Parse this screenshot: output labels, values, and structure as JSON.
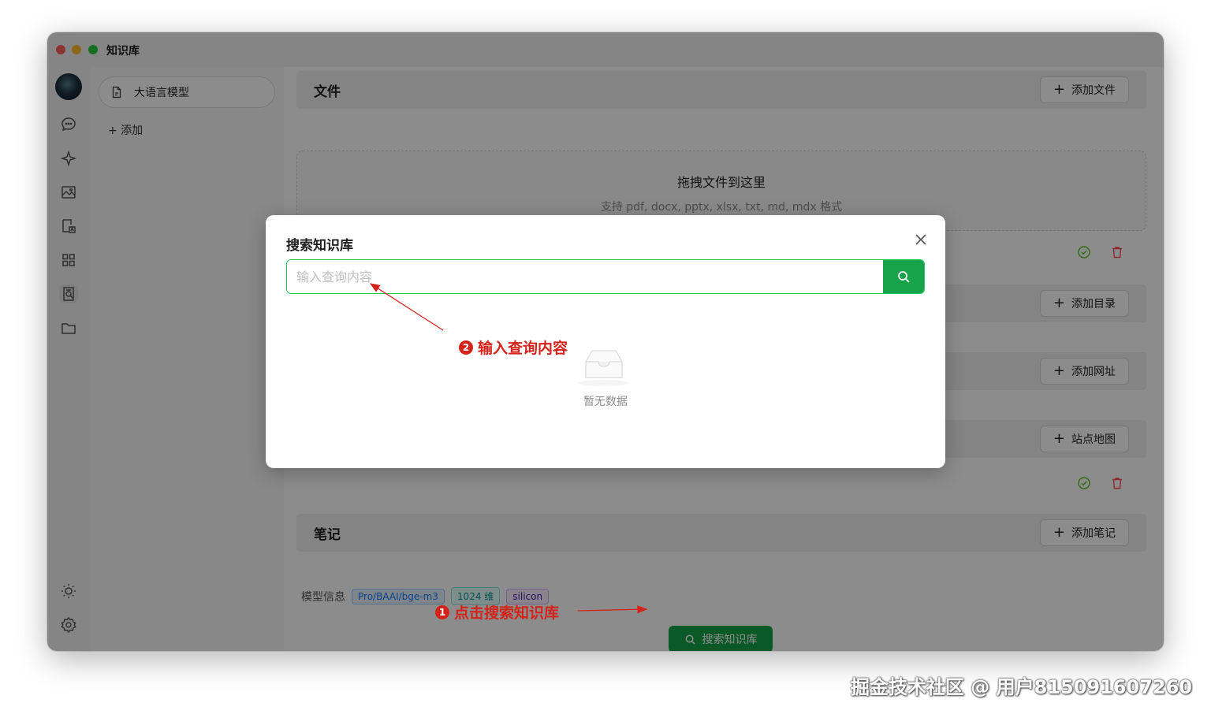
{
  "window": {
    "title": "知识库"
  },
  "leftbar": {
    "icons": [
      "chat-icon",
      "sparkle-icon",
      "image-icon",
      "translate-icon",
      "apps-icon",
      "knowledge-icon",
      "folder-icon",
      "theme-icon",
      "settings-icon"
    ]
  },
  "kb_sidebar": {
    "items": [
      {
        "label": "大语言模型"
      }
    ],
    "add_label": "+ 添加"
  },
  "content": {
    "files": {
      "title": "文件",
      "add_button": "添加文件",
      "dropzone_title": "拖拽文件到这里",
      "dropzone_sub": "支持 pdf, docx, pptx, xlsx, txt, md, mdx 格式"
    },
    "directory": {
      "add_button": "添加目录"
    },
    "urls": {
      "add_button": "添加网址"
    },
    "sitemap": {
      "add_button": "站点地图"
    },
    "notes": {
      "title": "笔记",
      "add_button": "添加笔记"
    },
    "model_info": {
      "label": "模型信息",
      "tags": [
        "Pro/BAAI/bge-m3",
        "1024 维",
        "silicon"
      ]
    },
    "search_kb_button": "搜索知识库"
  },
  "modal": {
    "title": "搜索知识库",
    "input_placeholder": "输入查询内容",
    "empty_text": "暂无数据"
  },
  "annotations": {
    "step1": {
      "num": "1",
      "text": "点击搜索知识库"
    },
    "step2": {
      "num": "2",
      "text": "输入查询内容"
    }
  },
  "colors": {
    "accent": "#16a34a",
    "annotation": "#d4231a",
    "success": "#52c41a",
    "danger": "#ff4d4f"
  },
  "watermark": "掘金技术社区 @ 用户815091607260"
}
